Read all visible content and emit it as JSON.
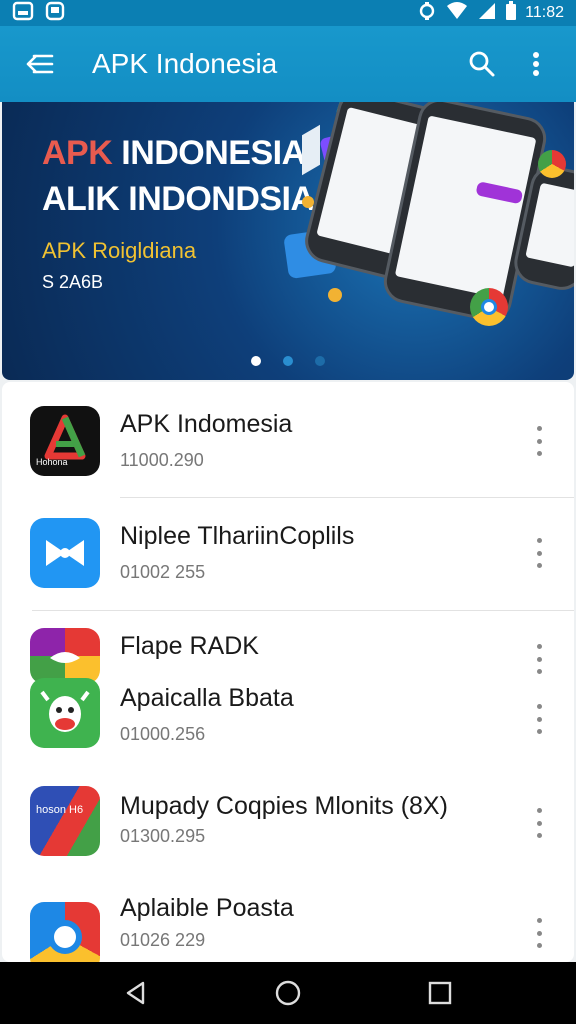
{
  "status_bar": {
    "time": "11:82"
  },
  "app_bar": {
    "title": "APK Indonesia"
  },
  "banner": {
    "line1_accent": "APK",
    "line1_rest": " INDONESIA",
    "line2": "ALIK INDONDSIA",
    "line3": "APK Roigldiana",
    "line4": "S 2A6B",
    "pages": 3,
    "active_page": 1
  },
  "apps": [
    {
      "name": "APK Indomesia",
      "meta": "11000.290",
      "icon": "apk-indonesia-icon",
      "icon_text": "Hohona"
    },
    {
      "name": "Niplee TlhariinCoplils",
      "meta": "01002 255",
      "icon": "blue-bow-icon",
      "icon_text": ""
    },
    {
      "name": "Flape RADK",
      "meta": "",
      "icon": "colorful-bird-icon",
      "icon_text": ""
    },
    {
      "name": "Apaicalla Bbata",
      "meta": "01000.256",
      "icon": "green-cow-icon",
      "icon_text": ""
    },
    {
      "name": "Mupady Coqpies Mlonits (8X)",
      "meta": "01300.295",
      "icon": "flag-book-icon",
      "icon_text": "hoson H6"
    },
    {
      "name": "Aplaible Poasta",
      "meta": "01026 229",
      "icon": "chrome-like-icon",
      "icon_text": ""
    }
  ],
  "colors": {
    "primary": "#138ec4",
    "status": "#0b7fb3",
    "accent_red": "#e85b4f",
    "accent_yellow": "#f1c232"
  }
}
